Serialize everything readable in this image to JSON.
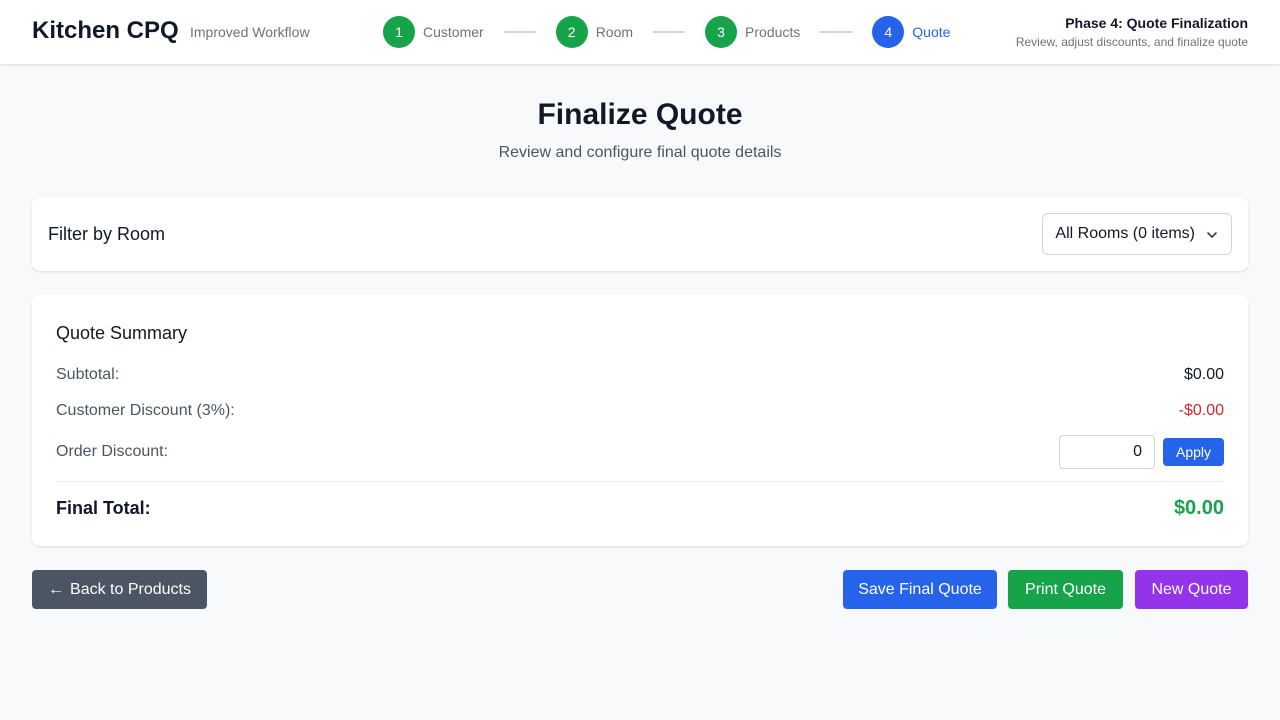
{
  "header": {
    "brand": "Kitchen CPQ",
    "subtitle": "Improved Workflow",
    "steps": [
      {
        "number": "1",
        "label": "Customer",
        "state": "done"
      },
      {
        "number": "2",
        "label": "Room",
        "state": "done"
      },
      {
        "number": "3",
        "label": "Products",
        "state": "done"
      },
      {
        "number": "4",
        "label": "Quote",
        "state": "active"
      }
    ],
    "phase_title": "Phase 4: Quote Finalization",
    "phase_subtitle": "Review, adjust discounts, and finalize quote"
  },
  "page": {
    "title": "Finalize Quote",
    "subtitle": "Review and configure final quote details"
  },
  "filter": {
    "label": "Filter by Room",
    "selected": "All Rooms (0 items)"
  },
  "summary": {
    "title": "Quote Summary",
    "subtotal_label": "Subtotal:",
    "subtotal_value": "$0.00",
    "customer_discount_label": "Customer Discount (3%):",
    "customer_discount_value": "-$0.00",
    "order_discount_label": "Order Discount:",
    "order_discount_value": "0",
    "apply_label": "Apply",
    "final_label": "Final Total:",
    "final_value": "$0.00"
  },
  "actions": {
    "back_arrow": "←",
    "back_label": "Back to Products",
    "save_label": "Save Final Quote",
    "print_label": "Print Quote",
    "new_label": "New Quote"
  },
  "colors": {
    "done": "#16a34a",
    "active": "#2563eb",
    "discount": "#dc2626",
    "total": "#16a34a",
    "new_quote": "#9333ea",
    "back": "#4b5563"
  }
}
